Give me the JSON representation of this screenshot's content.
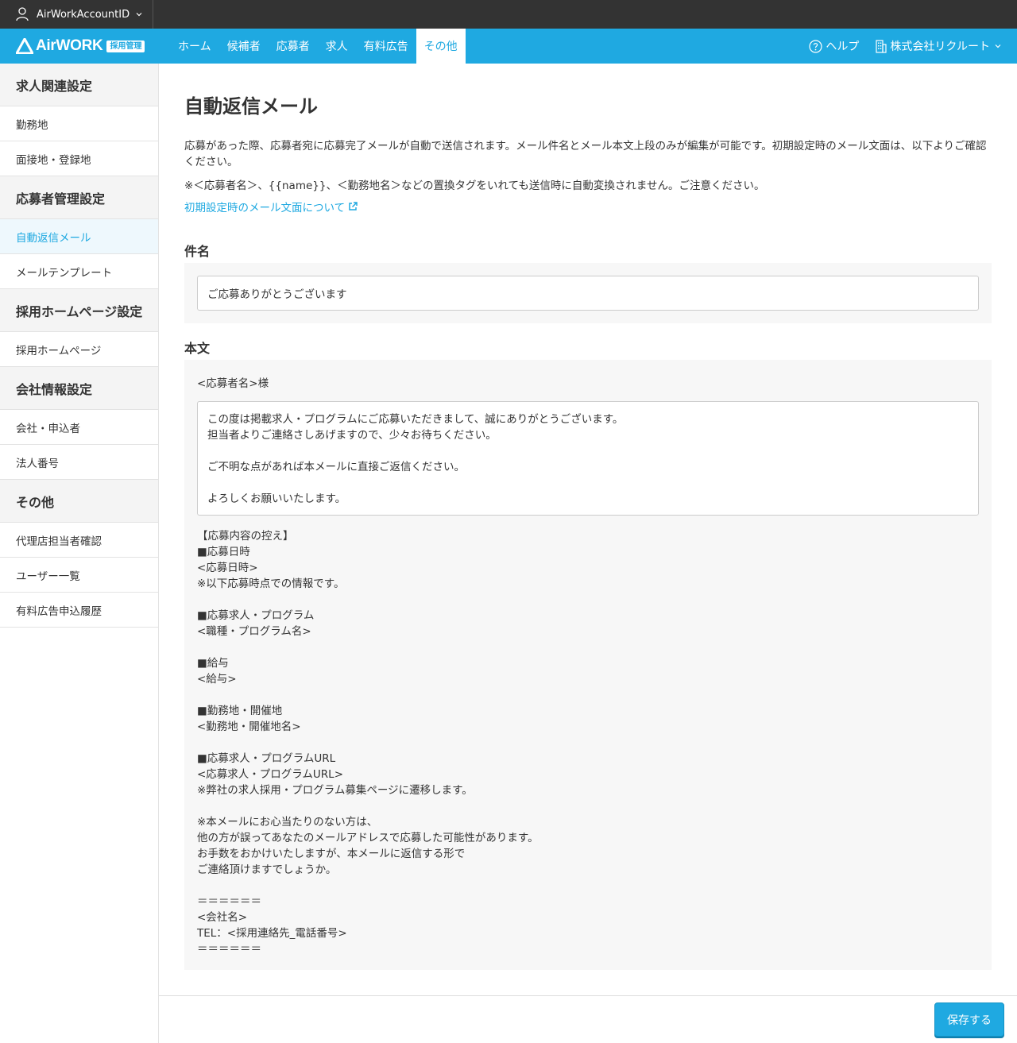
{
  "account": {
    "id": "AirWorkAccountID"
  },
  "nav": {
    "logo_text": "AirWORK",
    "logo_badge": "採用管理",
    "tabs": [
      "ホーム",
      "候補者",
      "応募者",
      "求人",
      "有料広告",
      "その他"
    ],
    "active_tab": "その他",
    "help": "ヘルプ",
    "company": "株式会社リクルート"
  },
  "sidebar": {
    "sections": [
      {
        "title": "求人関連設定",
        "items": [
          "勤務地",
          "面接地・登録地"
        ]
      },
      {
        "title": "応募者管理設定",
        "items": [
          "自動返信メール",
          "メールテンプレート"
        ]
      },
      {
        "title": "採用ホームページ設定",
        "items": [
          "採用ホームページ"
        ]
      },
      {
        "title": "会社情報設定",
        "items": [
          "会社・申込者",
          "法人番号"
        ]
      },
      {
        "title": "その他",
        "items": [
          "代理店担当者確認",
          "ユーザー一覧",
          "有料広告申込履歴"
        ]
      }
    ],
    "active_item": "自動返信メール"
  },
  "main": {
    "title": "自動返信メール",
    "description": "応募があった際、応募者宛に応募完了メールが自動で送信されます。メール件名とメール本文上段のみが編集が可能です。初期設定時のメール文面は、以下よりご確認ください。",
    "note": "※＜応募者名＞、{{name}}、＜勤務地名＞などの置換タグをいれても送信時に自動変換されません。ご注意ください。",
    "link": "初期設定時のメール文面について",
    "subject_label": "件名",
    "subject_value": "ご応募ありがとうございます",
    "body_label": "本文",
    "greeting": "<応募者名>様",
    "body_value": "この度は掲載求人・プログラムにご応募いただきまして、誠にありがとうございます。\n担当者よりご連絡さしあげますので、少々お待ちください。\n\nご不明な点があれば本メールに直接ご返信ください。\n\nよろしくお願いいたします。",
    "fixed_body": "【応募内容の控え】\n■応募日時\n<応募日時>\n※以下応募時点での情報です。\n\n■応募求人・プログラム\n<職種・プログラム名>\n\n■給与\n<給与>\n\n■勤務地・開催地\n<勤務地・開催地名>\n\n■応募求人・プログラムURL\n<応募求人・プログラムURL>\n※弊社の求人採用・プログラム募集ページに遷移します。\n\n※本メールにお心当たりのない方は、\n他の方が誤ってあなたのメールアドレスで応募した可能性があります。\nお手数をおかけいたしますが、本メールに返信する形で\nご連絡頂けますでしょうか。\n\n＝＝＝＝＝＝\n<会社名>\nTEL：<採用連絡先_電話番号>\n＝＝＝＝＝＝"
  },
  "footer": {
    "save": "保存する"
  },
  "colors": {
    "brand": "#1fa9e1",
    "topbar": "#333333",
    "panel": "#f7f7f7"
  }
}
